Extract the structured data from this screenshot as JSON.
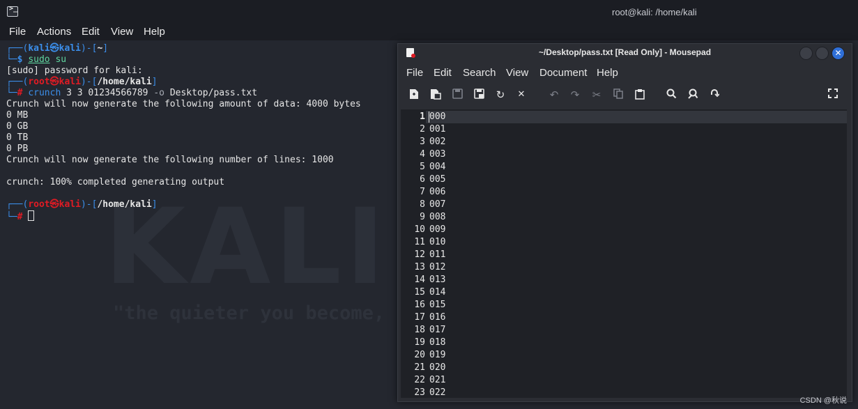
{
  "terminal": {
    "title": "root@kali: /home/kali",
    "menu": [
      "File",
      "Actions",
      "Edit",
      "View",
      "Help"
    ],
    "watermark": "KALI",
    "watermark_tagline": "\"the quieter you become, t",
    "prompt_user": {
      "corner_top": "┌──(",
      "user": "kali",
      "at": "㉿",
      "host": "kali",
      "close_open": ")-[",
      "path": "~",
      "close": "]",
      "corner_bottom": "└─",
      "symbol": "$"
    },
    "cmd1_a": "sudo",
    "cmd1_b": "su",
    "sudo_prompt": "[sudo] password for kali:",
    "prompt_root": {
      "corner_top": "┌──(",
      "user": "root",
      "at": "㉿",
      "host": "kali",
      "close_open": ")-[",
      "path": "/home/kali",
      "close": "]",
      "corner_bottom": "└─",
      "symbol": "#"
    },
    "cmd2_name": "crunch",
    "cmd2_args": "3 3 01234566789",
    "cmd2_opt": "-o",
    "cmd2_file": "Desktop/pass.txt",
    "output": [
      "Crunch will now generate the following amount of data: 4000 bytes",
      "0 MB",
      "0 GB",
      "0 TB",
      "0 PB",
      "Crunch will now generate the following number of lines: 1000",
      "",
      "crunch: 100% completed generating output"
    ]
  },
  "mousepad": {
    "title": "~/Desktop/pass.txt [Read Only] - Mousepad",
    "menu": [
      "File",
      "Edit",
      "Search",
      "View",
      "Document",
      "Help"
    ],
    "toolbar_icons": [
      "new-document-icon",
      "new-window-icon",
      "save-icon",
      "save-as-icon",
      "reload-icon",
      "close-tab-icon",
      "undo-icon",
      "redo-icon",
      "cut-icon",
      "copy-icon",
      "paste-icon",
      "find-icon",
      "find-replace-icon",
      "go-to-line-icon",
      "fullscreen-icon"
    ],
    "line_numbers": [
      "1",
      "2",
      "3",
      "4",
      "5",
      "6",
      "7",
      "8",
      "9",
      "10",
      "11",
      "12",
      "13",
      "14",
      "15",
      "16",
      "17",
      "18",
      "19",
      "20",
      "21",
      "22",
      "23"
    ],
    "lines": [
      "000",
      "001",
      "002",
      "003",
      "004",
      "005",
      "006",
      "007",
      "008",
      "009",
      "010",
      "011",
      "012",
      "013",
      "014",
      "015",
      "016",
      "017",
      "018",
      "019",
      "020",
      "021",
      "022"
    ]
  },
  "csdn_watermark": "CSDN @秋说",
  "colors": {
    "prompt_blue": "#3b8eea",
    "root_red": "#e01b24",
    "command_green": "#5fd7a0",
    "close_button_blue": "#2f6fd8"
  }
}
